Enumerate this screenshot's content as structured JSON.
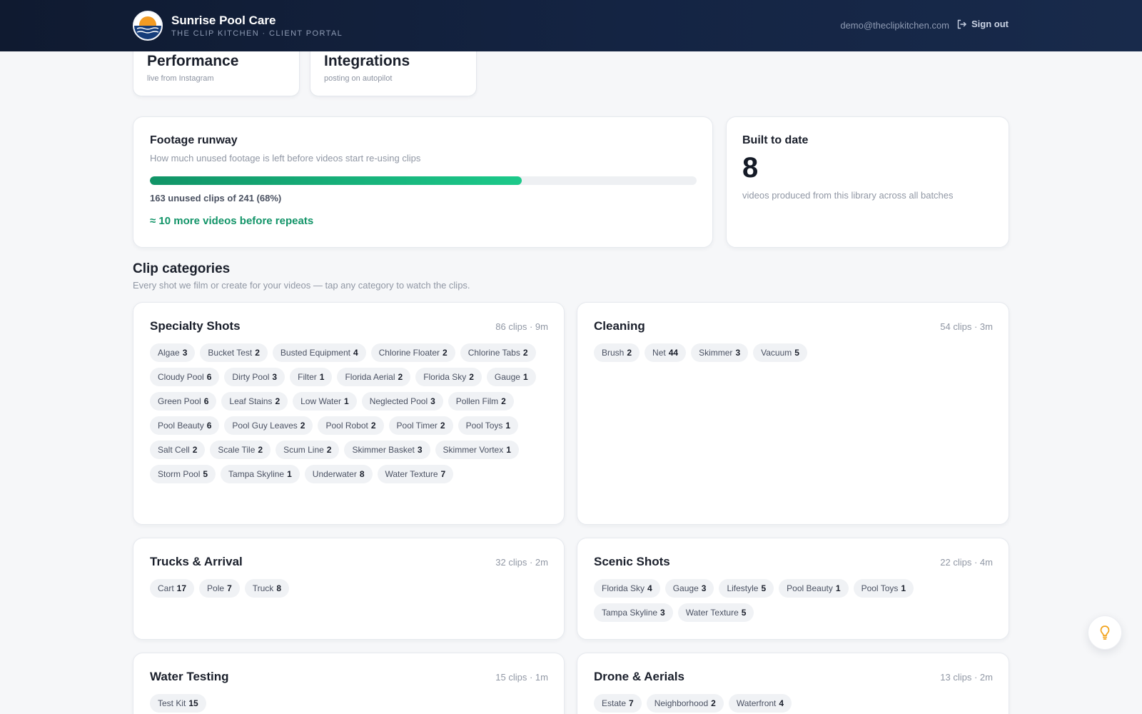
{
  "header": {
    "brand_name": "Sunrise Pool Care",
    "brand_sub": "THE CLIP KITCHEN · CLIENT PORTAL",
    "user_email": "demo@theclipkitchen.com",
    "signout_label": "Sign out"
  },
  "top_cards": [
    {
      "title": "Performance",
      "sub": "live from Instagram"
    },
    {
      "title": "Integrations",
      "sub": "posting on autopilot"
    }
  ],
  "runway": {
    "title": "Footage runway",
    "desc": "How much unused footage is left before videos start re-using clips",
    "progress_fraction": 0.68,
    "stat": "163 unused clips of 241 (68%)",
    "cta": "≈ 10 more videos before repeats",
    "accent": "#129468"
  },
  "built": {
    "title": "Built to date",
    "value": "8",
    "desc": "videos produced from this library across all batches"
  },
  "clip_section": {
    "title": "Clip categories",
    "sub": "Every shot we film or create for your videos — tap any category to watch the clips."
  },
  "categories": [
    {
      "name": "Specialty Shots",
      "meta": "86 clips · 9m",
      "chips": [
        {
          "label": "Algae",
          "count": "3"
        },
        {
          "label": "Bucket Test",
          "count": "2"
        },
        {
          "label": "Busted Equipment",
          "count": "4"
        },
        {
          "label": "Chlorine Floater",
          "count": "2"
        },
        {
          "label": "Chlorine Tabs",
          "count": "2"
        },
        {
          "label": "Cloudy Pool",
          "count": "6"
        },
        {
          "label": "Dirty Pool",
          "count": "3"
        },
        {
          "label": "Filter",
          "count": "1"
        },
        {
          "label": "Florida Aerial",
          "count": "2"
        },
        {
          "label": "Florida Sky",
          "count": "2"
        },
        {
          "label": "Gauge",
          "count": "1"
        },
        {
          "label": "Green Pool",
          "count": "6"
        },
        {
          "label": "Leaf Stains",
          "count": "2"
        },
        {
          "label": "Low Water",
          "count": "1"
        },
        {
          "label": "Neglected Pool",
          "count": "3"
        },
        {
          "label": "Pollen Film",
          "count": "2"
        },
        {
          "label": "Pool Beauty",
          "count": "6"
        },
        {
          "label": "Pool Guy Leaves",
          "count": "2"
        },
        {
          "label": "Pool Robot",
          "count": "2"
        },
        {
          "label": "Pool Timer",
          "count": "2"
        },
        {
          "label": "Pool Toys",
          "count": "1"
        },
        {
          "label": "Salt Cell",
          "count": "2"
        },
        {
          "label": "Scale Tile",
          "count": "2"
        },
        {
          "label": "Scum Line",
          "count": "2"
        },
        {
          "label": "Skimmer Basket",
          "count": "3"
        },
        {
          "label": "Skimmer Vortex",
          "count": "1"
        },
        {
          "label": "Storm Pool",
          "count": "5"
        },
        {
          "label": "Tampa Skyline",
          "count": "1"
        },
        {
          "label": "Underwater",
          "count": "8"
        },
        {
          "label": "Water Texture",
          "count": "7"
        }
      ]
    },
    {
      "name": "Cleaning",
      "meta": "54 clips · 3m",
      "chips": [
        {
          "label": "Brush",
          "count": "2"
        },
        {
          "label": "Net",
          "count": "44"
        },
        {
          "label": "Skimmer",
          "count": "3"
        },
        {
          "label": "Vacuum",
          "count": "5"
        }
      ]
    },
    {
      "name": "Trucks & Arrival",
      "meta": "32 clips · 2m",
      "chips": [
        {
          "label": "Cart",
          "count": "17"
        },
        {
          "label": "Pole",
          "count": "7"
        },
        {
          "label": "Truck",
          "count": "8"
        }
      ]
    },
    {
      "name": "Scenic Shots",
      "meta": "22 clips · 4m",
      "chips": [
        {
          "label": "Florida Sky",
          "count": "4"
        },
        {
          "label": "Gauge",
          "count": "3"
        },
        {
          "label": "Lifestyle",
          "count": "5"
        },
        {
          "label": "Pool Beauty",
          "count": "1"
        },
        {
          "label": "Pool Toys",
          "count": "1"
        },
        {
          "label": "Tampa Skyline",
          "count": "3"
        },
        {
          "label": "Water Texture",
          "count": "5"
        }
      ]
    },
    {
      "name": "Water Testing",
      "meta": "15 clips · 1m",
      "chips": [
        {
          "label": "Test Kit",
          "count": "15"
        }
      ]
    },
    {
      "name": "Drone & Aerials",
      "meta": "13 clips · 2m",
      "chips": [
        {
          "label": "Estate",
          "count": "7"
        },
        {
          "label": "Neighborhood",
          "count": "2"
        },
        {
          "label": "Waterfront",
          "count": "4"
        }
      ]
    }
  ],
  "icons": {
    "logo": "sunrise-logo-icon",
    "signout": "sign-out-icon",
    "help": "lightbulb-icon"
  }
}
